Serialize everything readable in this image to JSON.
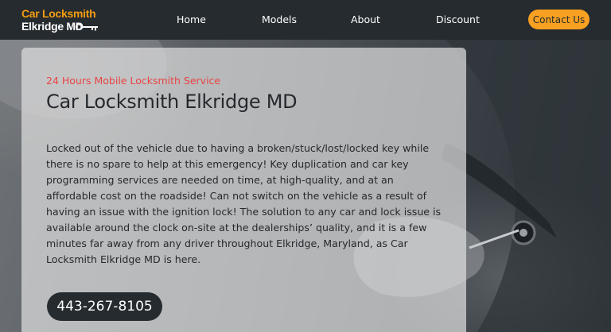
{
  "brand": {
    "line1": "Car Locksmith",
    "line2": "Elkridge MD",
    "logo_icon": "key-icon",
    "colors": {
      "accent": "#f39c12",
      "text": "#ffffff"
    }
  },
  "nav": {
    "items": [
      {
        "label": "Home"
      },
      {
        "label": "Models"
      },
      {
        "label": "About"
      },
      {
        "label": "Discount"
      }
    ],
    "contact_label": "Contact Us"
  },
  "hero": {
    "tagline": "24 Hours Mobile Locksmith Service",
    "title": "Car Locksmith Elkridge MD",
    "body": "Locked out of the vehicle due to having a broken/stuck/lost/locked key while there is no spare to help at this emergency! Key duplication and car key programming services are needed on time, at high-quality, and at an affordable cost on the roadside! Can not switch on the vehicle as a result of having an issue with the ignition lock! The solution to any car and lock issue is available around the clock on-site at the dealerships’ quality, and it is a few minutes far away from any driver throughout Elkridge, Maryland, as Car Locksmith Elkridge MD is here.",
    "phone": "443-267-8105"
  },
  "colors": {
    "navbar": "#262b2f",
    "contact_button": "#f7a021",
    "tagline": "#e84545",
    "phone_button": "#262b2f"
  }
}
